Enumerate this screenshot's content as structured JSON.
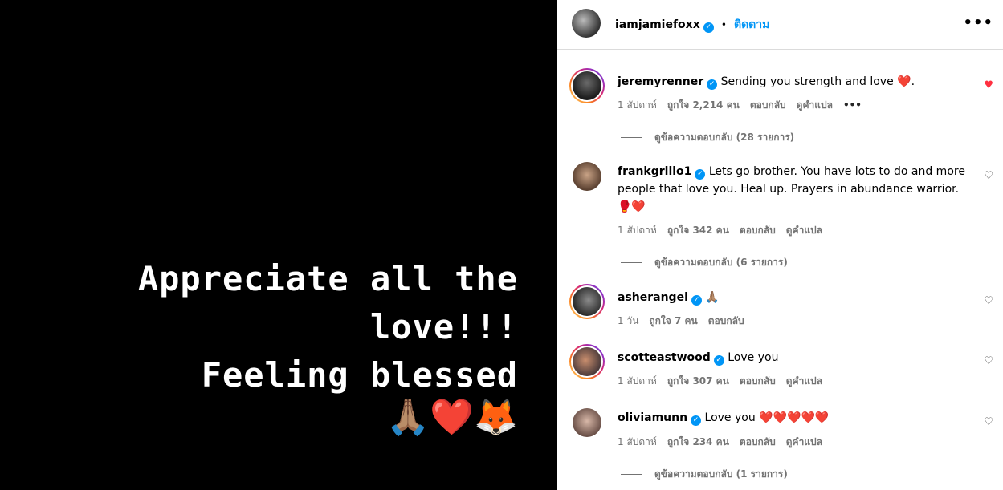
{
  "media": {
    "lines": [
      "Appreciate all the",
      "love!!!",
      "Feeling blessed"
    ],
    "emoji": "🙏🏽❤️🦊"
  },
  "header": {
    "username": "iamjamiefoxx",
    "separator": "•",
    "follow_label": "ติดตาม",
    "more_icon": "•••"
  },
  "comments": [
    {
      "username": "jeremyrenner",
      "text": "Sending you strength and love ❤️.",
      "time": "1 สัปดาห์",
      "likes": "ถูกใจ 2,214 คน",
      "reply": "ตอบกลับ",
      "translate": "ดูคำแปล",
      "more": "•••",
      "replies": "ดูข้อความตอบกลับ (28 รายการ)",
      "liked": true
    },
    {
      "username": "frankgrillo1",
      "text": "Lets go brother. You have lots to do and more people that love you. Heal up. Prayers in abundance warrior. 🥊❤️",
      "time": "1 สัปดาห์",
      "likes": "ถูกใจ 342 คน",
      "reply": "ตอบกลับ",
      "translate": "ดูคำแปล",
      "replies": "ดูข้อความตอบกลับ (6 รายการ)",
      "liked": false
    },
    {
      "username": "asherangel",
      "text": "🙏🏽",
      "time": "1 วัน",
      "likes": "ถูกใจ 7 คน",
      "reply": "ตอบกลับ",
      "liked": false
    },
    {
      "username": "scotteastwood",
      "text": "Love you",
      "time": "1 สัปดาห์",
      "likes": "ถูกใจ 307 คน",
      "reply": "ตอบกลับ",
      "translate": "ดูคำแปล",
      "liked": false
    },
    {
      "username": "oliviamunn",
      "text": "Love you ❤️❤️❤️❤️❤️",
      "time": "1 สัปดาห์",
      "likes": "ถูกใจ 234 คน",
      "reply": "ตอบกลับ",
      "translate": "ดูคำแปล",
      "replies": "ดูข้อความตอบกลับ (1 รายการ)",
      "liked": false
    }
  ],
  "icons": {
    "verified": "verified-badge-icon",
    "heart": "heart-icon"
  },
  "colors": {
    "accent": "#0095f6",
    "liked": "#ff3040",
    "muted": "#737373"
  }
}
